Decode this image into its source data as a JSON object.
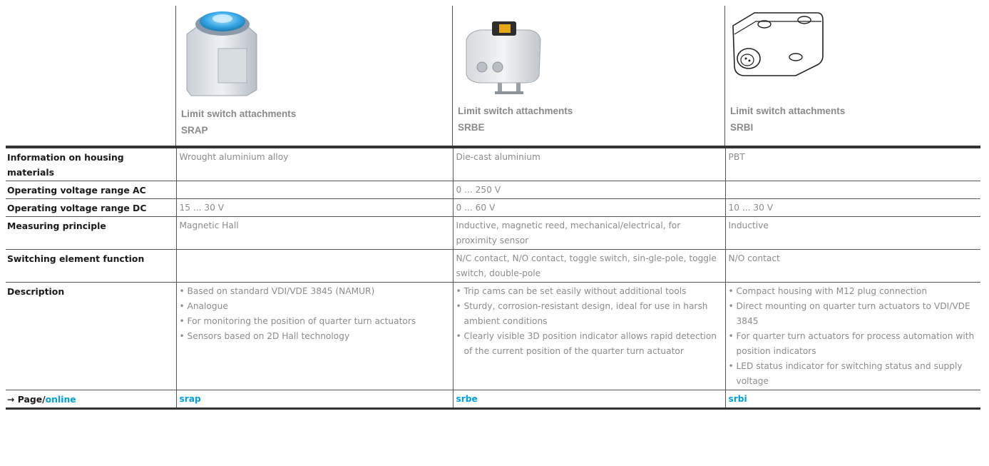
{
  "products": [
    {
      "title": "Limit switch attachments",
      "code": "SRAP",
      "image": "srap-product-image"
    },
    {
      "title": "Limit switch attachments",
      "code": "SRBE",
      "image": "srbe-product-image"
    },
    {
      "title": "Limit switch attachments",
      "code": "SRBI",
      "image": "srbi-product-image"
    }
  ],
  "rows": {
    "housing": {
      "label": "Information on housing materials",
      "values": [
        "Wrought aluminium alloy",
        "Die-cast aluminium",
        "PBT"
      ]
    },
    "vac": {
      "label": "Operating voltage range AC",
      "values": [
        "",
        "0 ... 250 V",
        ""
      ]
    },
    "vdc": {
      "label": "Operating voltage range DC",
      "values": [
        "15 ... 30 V",
        "0 ... 60 V",
        "10 ... 30 V"
      ]
    },
    "measuring": {
      "label": "Measuring principle",
      "values": [
        "Magnetic Hall",
        "Inductive, magnetic reed, mechanical/electrical, for proximity sensor",
        "Inductive"
      ]
    },
    "switching": {
      "label": "Switching element function",
      "values": [
        "",
        "N/C contact, N/O contact, toggle switch, sin-gle-pole, toggle switch, double-pole",
        "N/O contact"
      ]
    },
    "description": {
      "label": "Description",
      "srap": [
        "Based on standard VDI/VDE 3845 (NAMUR)",
        "Analogue",
        "For monitoring the position of quarter turn actuators",
        "Sensors based on 2D Hall technology"
      ],
      "srbe": [
        "Trip cams can be set easily without additional tools",
        "Sturdy, corrosion-resistant design, ideal for use in harsh ambient conditions",
        "Clearly visible 3D position indicator allows rapid detection of the current position of the quarter turn actuator"
      ],
      "srbi": [
        "Compact housing with M12 plug connection",
        "Direct mounting on quarter turn actuators to VDI/VDE 3845",
        "For quarter turn actuators for process automation with position indicators",
        "LED status indicator for switching status and supply voltage"
      ]
    },
    "page": {
      "arrow": "→",
      "label_page": "Page/",
      "label_online": "online",
      "links": [
        "srap",
        "srbe",
        "srbi"
      ]
    }
  },
  "colors": {
    "link": "#00a0dc",
    "value_text": "#8c8c8c",
    "label_text": "#1a1a1a",
    "header_text": "#8a8a8a"
  }
}
